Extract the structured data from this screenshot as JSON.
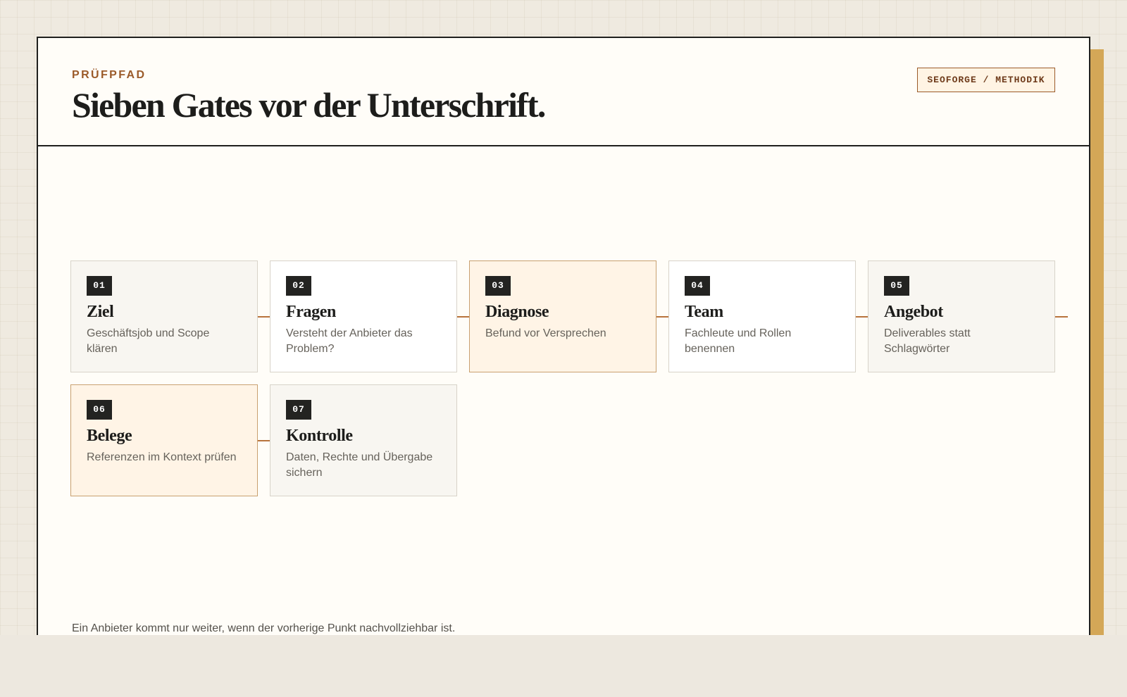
{
  "header": {
    "eyebrow": "PRÜFPFAD",
    "title": "Sieben Gates vor der Unterschrift.",
    "badge": "SEOFORGE / METHODIK"
  },
  "gates": [
    {
      "num": "01",
      "title": "Ziel",
      "desc": "Geschäftsjob und Scope klären"
    },
    {
      "num": "02",
      "title": "Fragen",
      "desc": "Versteht der Anbieter das Problem?"
    },
    {
      "num": "03",
      "title": "Diagnose",
      "desc": "Befund vor Versprechen"
    },
    {
      "num": "04",
      "title": "Team",
      "desc": "Fachleute und Rollen benennen"
    },
    {
      "num": "05",
      "title": "Angebot",
      "desc": "Deliverables statt Schlagwörter"
    },
    {
      "num": "06",
      "title": "Belege",
      "desc": "Referenzen im Kontext prüfen"
    },
    {
      "num": "07",
      "title": "Kontrolle",
      "desc": "Daten, Rechte und Übergabe sichern"
    }
  ],
  "footer": {
    "note": "Ein Anbieter kommt nur weiter, wenn der vorherige Punkt nachvollziehbar ist."
  },
  "colors": {
    "accent": "#9b5b2a",
    "connector": "#b8733c",
    "shadow": "#d4a757",
    "highlight_card": "#fff4e6"
  }
}
